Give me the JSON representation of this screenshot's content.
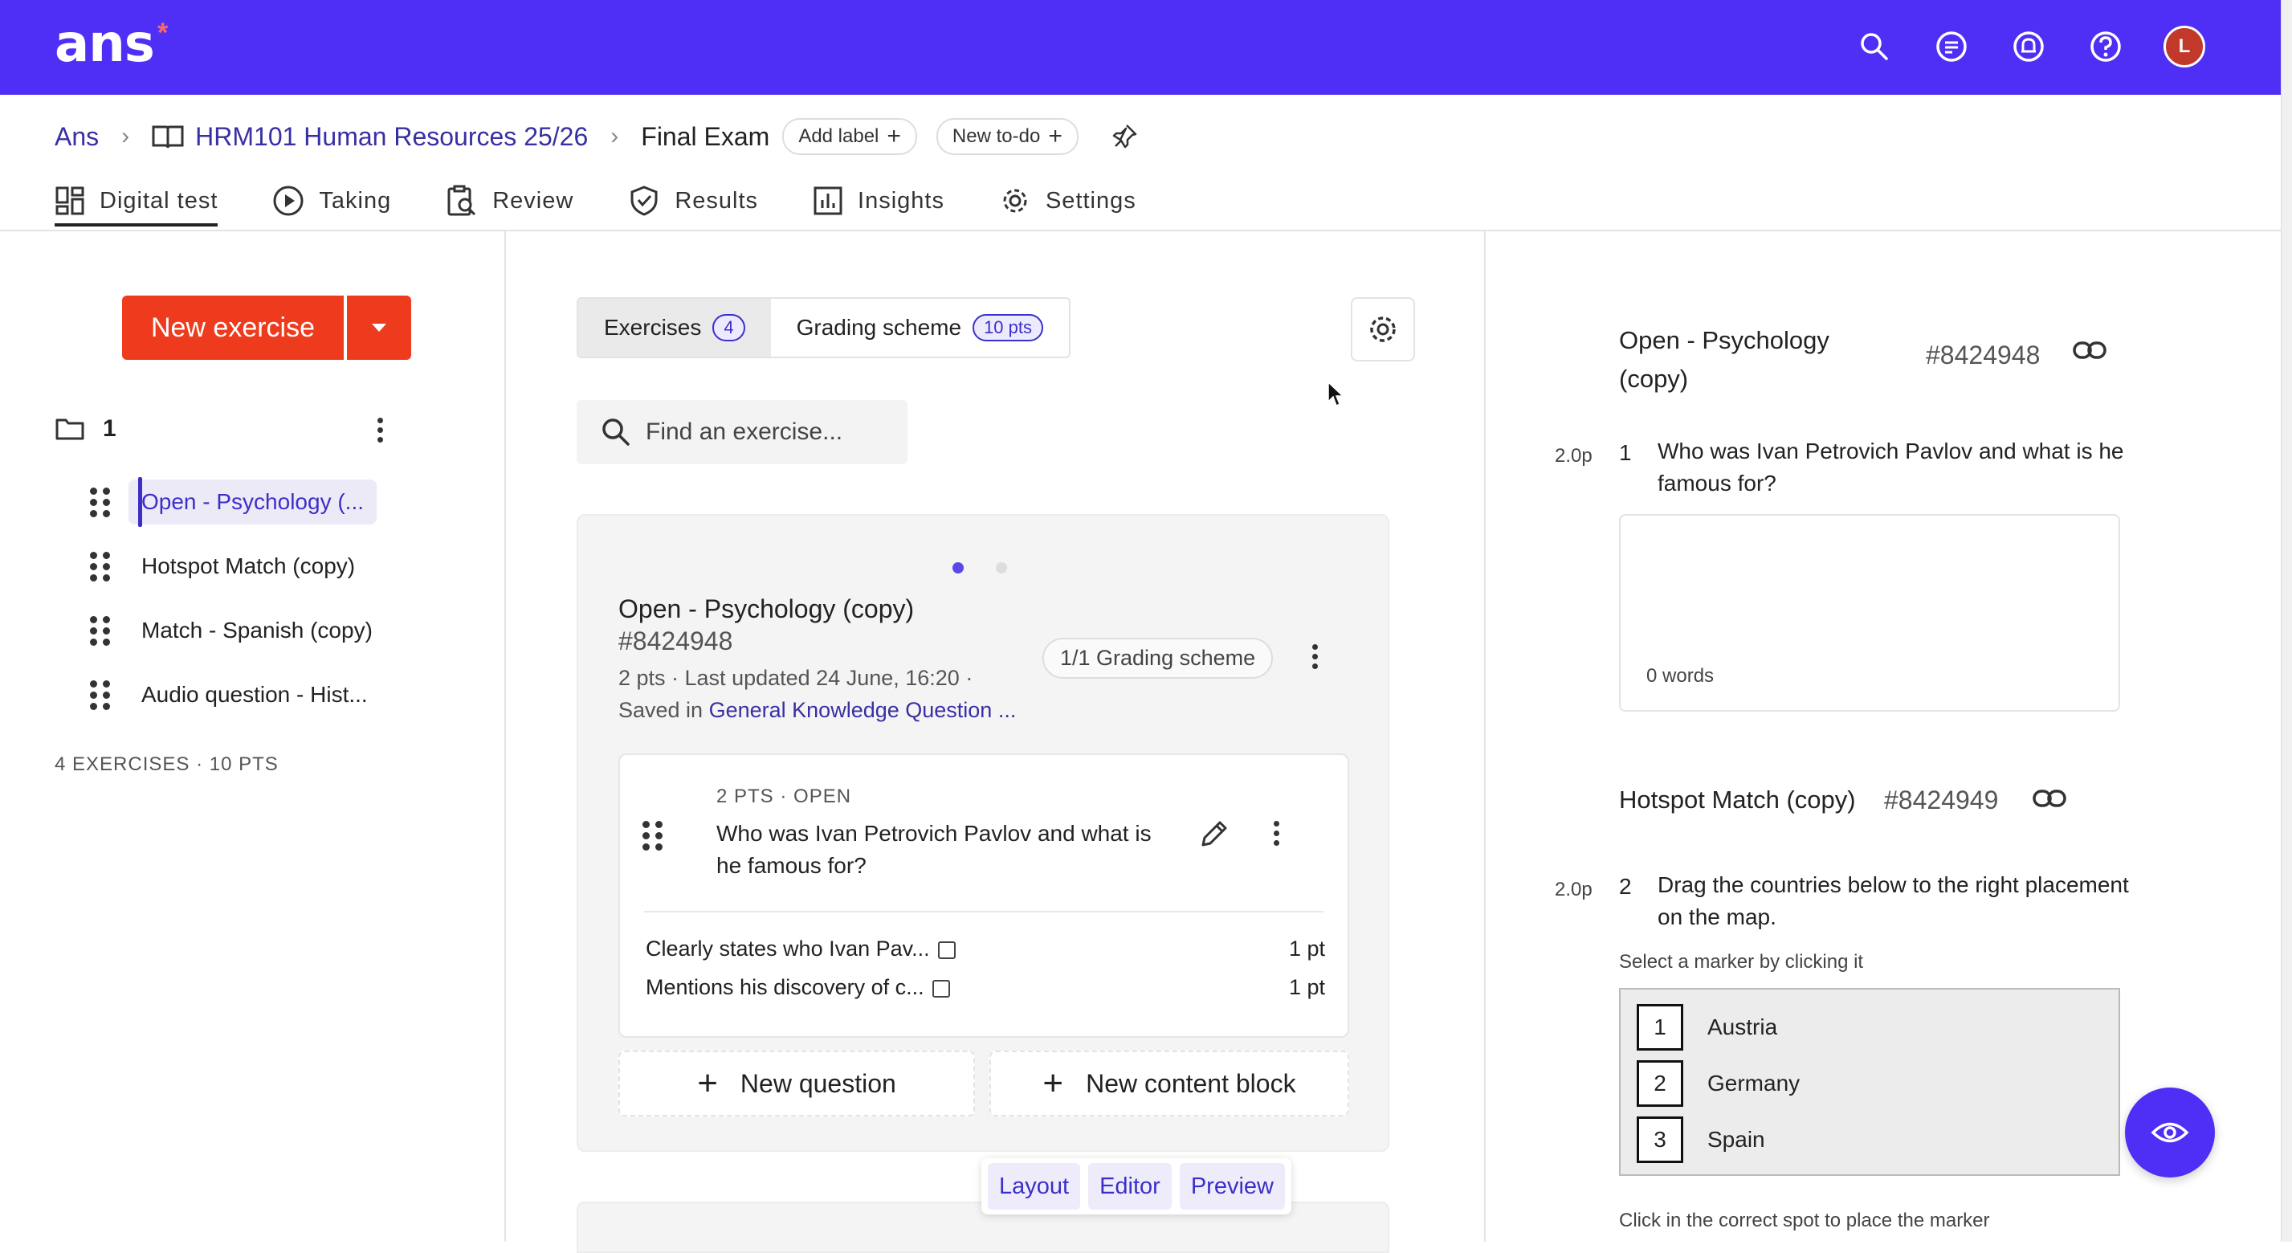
{
  "app": {
    "logo": "ans",
    "logo_mark": "*",
    "avatar_initial": "L"
  },
  "topbar_icons": [
    "search-icon",
    "feedback-icon",
    "notifications-icon",
    "help-icon"
  ],
  "breadcrumb": {
    "root": "Ans",
    "course": "HRM101 Human Resources 25/26",
    "current": "Final Exam",
    "add_label": "Add label",
    "new_todo": "New to-do"
  },
  "tabs": [
    {
      "label": "Digital test",
      "icon": "grid-icon",
      "active": true
    },
    {
      "label": "Taking",
      "icon": "play-circle-icon"
    },
    {
      "label": "Review",
      "icon": "review-icon"
    },
    {
      "label": "Results",
      "icon": "shield-check-icon"
    },
    {
      "label": "Insights",
      "icon": "bar-chart-icon"
    },
    {
      "label": "Settings",
      "icon": "gear-icon"
    }
  ],
  "sidebar": {
    "new_exercise": "New exercise",
    "folder_name": "1",
    "exercises": [
      {
        "label": "Open - Psychology (...",
        "active": true
      },
      {
        "label": "Hotspot Match (copy)"
      },
      {
        "label": "Match - Spanish (copy)"
      },
      {
        "label": "Audio question - Hist..."
      }
    ],
    "summary": "4 EXERCISES · 10 PTS"
  },
  "middle": {
    "seg_exercises": "Exercises",
    "seg_exercises_count": "4",
    "seg_grading": "Grading scheme",
    "seg_grading_pts": "10 pts",
    "search_placeholder": "Find an exercise...",
    "card": {
      "title": "Open - Psychology (copy)",
      "id": "#8424948",
      "meta_line1": "2 pts · Last updated 24 June, 16:20 ·",
      "meta_saved": "Saved in",
      "meta_link": "General Knowledge Question ...",
      "grading_chip": "1/1 Grading scheme",
      "question": {
        "meta": "2 PTS · OPEN",
        "text": "Who was Ivan Petrovich Pavlov and what is he famous for?",
        "criteria": [
          {
            "label": "Clearly states who Ivan Pav...",
            "pts": "1 pt"
          },
          {
            "label": "Mentions his discovery of c...",
            "pts": "1 pt"
          }
        ]
      },
      "new_question": "New question",
      "new_content_block": "New content block"
    },
    "view_toggle": [
      "Layout",
      "Editor",
      "Preview"
    ]
  },
  "preview": {
    "ex1_title": "Open - Psychology (copy)",
    "ex1_id": "#8424948",
    "q1_pts": "2.0p",
    "q1_num": "1",
    "q1_text": "Who was Ivan Petrovich Pavlov and what is he famous for?",
    "q1_wordcount": "0 words",
    "ex2_title": "Hotspot Match (copy)",
    "ex2_id": "#8424949",
    "q2_pts": "2.0p",
    "q2_num": "2",
    "q2_text": "Drag the countries below to the right placement on the map.",
    "q2_hint": "Select a marker by clicking it",
    "markers": [
      {
        "n": "1",
        "label": "Austria"
      },
      {
        "n": "2",
        "label": "Germany"
      },
      {
        "n": "3",
        "label": "Spain"
      }
    ],
    "q2_hint2": "Click in the correct spot to place the marker"
  },
  "colors": {
    "brand": "#4f2ff5",
    "primary_button": "#ef3b1d",
    "link": "#3730a3"
  }
}
